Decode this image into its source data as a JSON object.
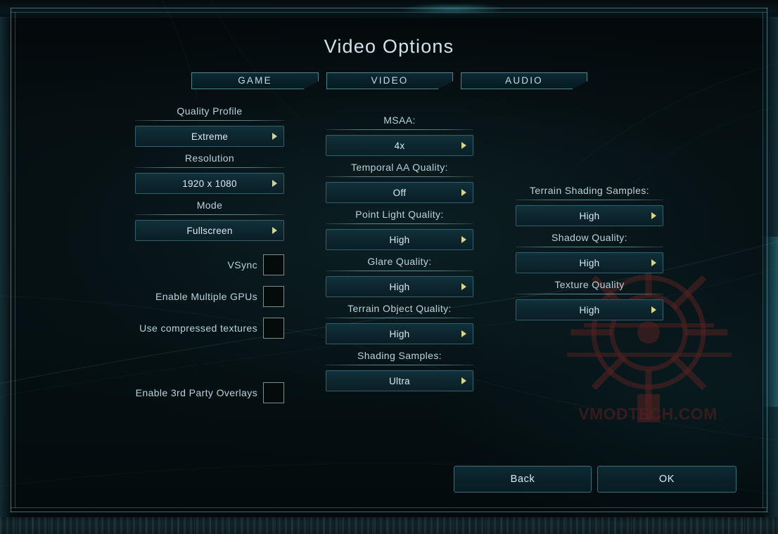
{
  "window": {
    "title": "Video Options"
  },
  "tabs": [
    {
      "label": "GAME",
      "selected": false
    },
    {
      "label": "VIDEO",
      "selected": true
    },
    {
      "label": "AUDIO",
      "selected": false
    }
  ],
  "columns": {
    "left": {
      "dropdowns": [
        {
          "label": "Quality Profile",
          "value": "Extreme"
        },
        {
          "label": "Resolution",
          "value": "1920 x 1080"
        },
        {
          "label": "Mode",
          "value": "Fullscreen"
        }
      ],
      "checkboxes": [
        {
          "label": "VSync",
          "checked": false
        },
        {
          "label": "Enable Multiple GPUs",
          "checked": false
        },
        {
          "label": "Use compressed textures",
          "checked": false
        },
        {
          "label": "Enable 3rd Party Overlays",
          "checked": false
        }
      ]
    },
    "middle": {
      "dropdowns": [
        {
          "label": "MSAA:",
          "value": "4x"
        },
        {
          "label": "Temporal AA Quality:",
          "value": "Off"
        },
        {
          "label": "Point Light Quality:",
          "value": "High"
        },
        {
          "label": "Glare Quality:",
          "value": "High"
        },
        {
          "label": "Terrain Object Quality:",
          "value": "High"
        },
        {
          "label": "Shading Samples:",
          "value": "Ultra"
        }
      ]
    },
    "right": {
      "dropdowns": [
        {
          "label": "Terrain Shading Samples:",
          "value": "High"
        },
        {
          "label": "Shadow Quality:",
          "value": "High"
        },
        {
          "label": "Texture Quality",
          "value": "High"
        }
      ]
    }
  },
  "footer": {
    "back_label": "Back",
    "ok_label": "OK"
  },
  "watermark": {
    "text": "VMODTECH.COM"
  },
  "colors": {
    "accent_arrow": "#d9d58a",
    "text_primary": "#dceaf0",
    "text_label": "#b9d3dc",
    "frame_line": "#76bcc6",
    "dropdown_border": "#2f6170",
    "watermark": "#561e1e"
  }
}
